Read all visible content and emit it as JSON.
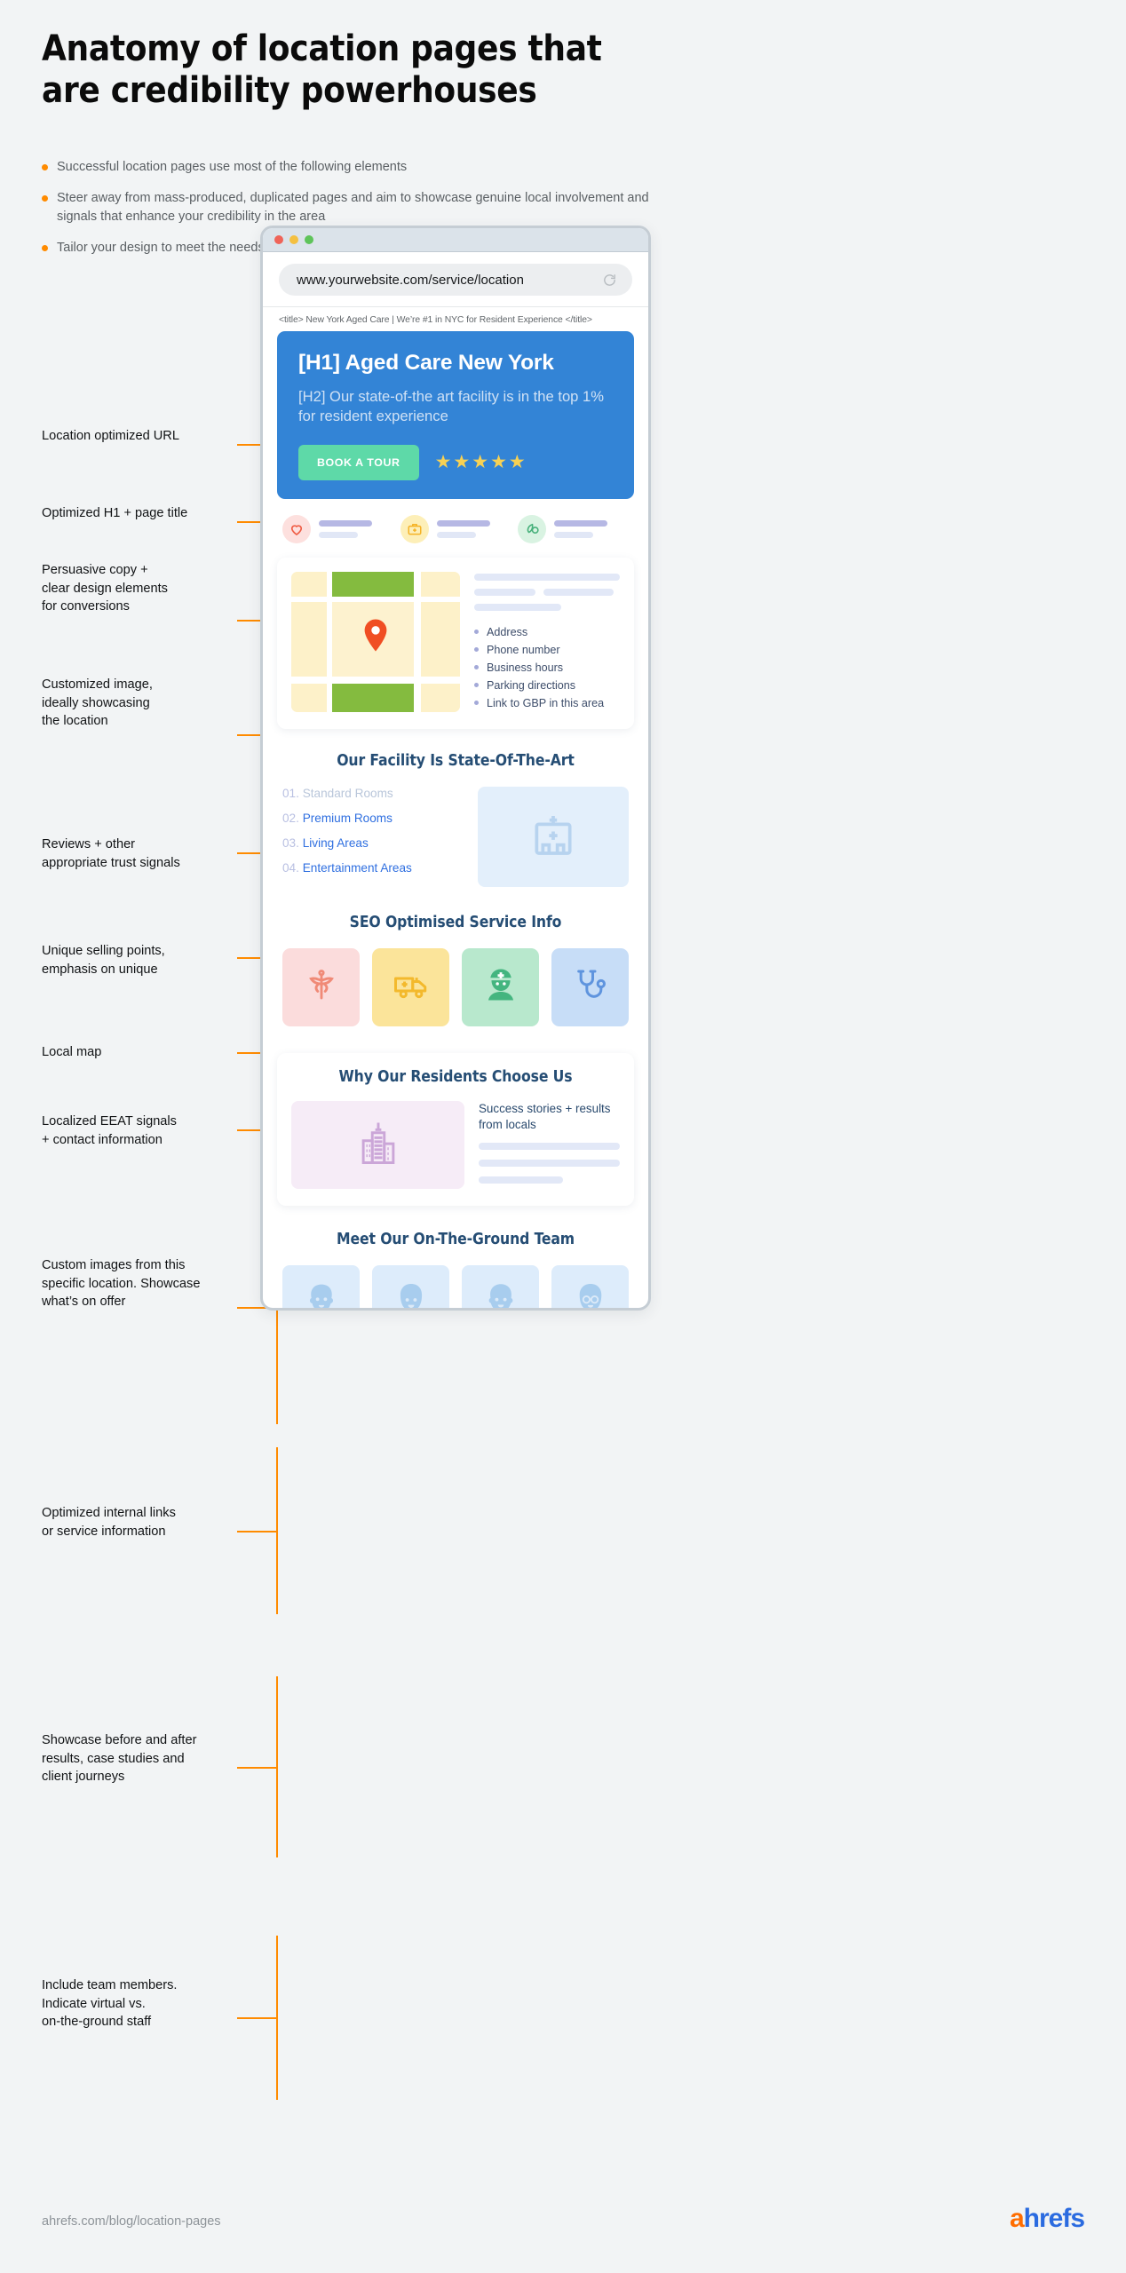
{
  "header": {
    "title": "Anatomy of location pages that are credibility powerhouses",
    "bullets": [
      "Successful location pages use most of the following elements",
      "Steer away from mass-produced, duplicated pages and aim to showcase genuine local involvement and signals that enhance your credibility in the area",
      "Tailor your design to meet the needs of your business and your customer’s search intent"
    ]
  },
  "annotations": [
    {
      "id": "url",
      "text": "Location optimized URL"
    },
    {
      "id": "h1",
      "text": "Optimized H1 + page title"
    },
    {
      "id": "copy",
      "text": "Persuasive copy +\nclear design elements\nfor conversions"
    },
    {
      "id": "image",
      "text": "Customized image,\nideally showcasing\nthe location"
    },
    {
      "id": "reviews",
      "text": "Reviews + other\nappropriate trust signals"
    },
    {
      "id": "usp",
      "text": "Unique selling points,\nemphasis on unique"
    },
    {
      "id": "map",
      "text": "Local map"
    },
    {
      "id": "eeat",
      "text": "Localized EEAT signals\n+ contact information"
    },
    {
      "id": "customimg",
      "text": "Custom images from this\nspecific location. Showcase\nwhat’s on offer"
    },
    {
      "id": "internal",
      "text": "Optimized internal links\nor service information"
    },
    {
      "id": "beforeafter",
      "text": "Showcase before and after\nresults, case studies and\nclient journeys"
    },
    {
      "id": "teamlabel",
      "text": "Include team members.\nIndicate virtual vs.\non-the-ground staff"
    }
  ],
  "browser": {
    "traffic_lights": [
      "red",
      "yellow",
      "green"
    ],
    "url": "www.yourwebsite.com/service/location",
    "reload_icon": "reload-icon",
    "meta_title": "<title> New York Aged Care | We’re #1 in NYC for Resident Experience </title>"
  },
  "hero": {
    "h1": "[H1] Aged Care New York",
    "h2": "[H2] Our state-of-the art facility is in the top 1% for resident experience",
    "cta_label": "BOOK A TOUR",
    "stars": 5,
    "bg_color": "#3384d6",
    "cta_color": "#5ed9a8",
    "star_color": "#f7d154"
  },
  "trust_signals": [
    {
      "icon": "heart-icon",
      "circle_color": "#fde0de",
      "icon_color": "#ef5d45"
    },
    {
      "icon": "medical-bag-icon",
      "circle_color": "#fdefb8",
      "icon_color": "#f5b326"
    },
    {
      "icon": "eco-leaf-icon",
      "circle_color": "#d9f3e2",
      "icon_color": "#46b07a"
    }
  ],
  "map_section": {
    "map_pin_color": "#f04e23",
    "contact_items": [
      "Address",
      "Phone number",
      "Business hours",
      "Parking directions",
      "Link to GBP in this area"
    ]
  },
  "facility": {
    "title": "Our Facility Is State-Of-The-Art",
    "items": [
      {
        "num": "01.",
        "label": "Standard Rooms",
        "muted": true
      },
      {
        "num": "02.",
        "label": "Premium Rooms",
        "muted": false
      },
      {
        "num": "03.",
        "label": "Living Areas",
        "muted": false
      },
      {
        "num": "04.",
        "label": "Entertainment Areas",
        "muted": false
      }
    ],
    "image_icon": "hospital-building-icon"
  },
  "services": {
    "title": "SEO Optimised Service Info",
    "icons": [
      {
        "icon": "caduceus-icon",
        "bg": "#fbdcdc",
        "color": "#f08a77"
      },
      {
        "icon": "ambulance-icon",
        "bg": "#fbe49a",
        "color": "#f3b92c"
      },
      {
        "icon": "nurse-icon",
        "bg": "#b8e8cd",
        "color": "#44b57f"
      },
      {
        "icon": "stethoscope-icon",
        "bg": "#c7ddf7",
        "color": "#5f94de"
      }
    ]
  },
  "why_section": {
    "title": "Why Our Residents Choose Us",
    "image_icon": "city-buildings-icon",
    "lead": "Success stories + results from locals"
  },
  "team_section": {
    "title": "Meet Our On-The-Ground Team",
    "avatars": [
      "bearded-man-avatar-icon",
      "woman-avatar-icon",
      "curly-man-avatar-icon",
      "glasses-woman-avatar-icon"
    ]
  },
  "footer": {
    "source_url": "ahrefs.com/blog/location-pages",
    "brand_a": "a",
    "brand_hrefs": "hrefs"
  },
  "colors": {
    "accent_orange": "#ff8b00",
    "page_bg": "#f2f4f5",
    "heading_navy": "#254d74"
  }
}
